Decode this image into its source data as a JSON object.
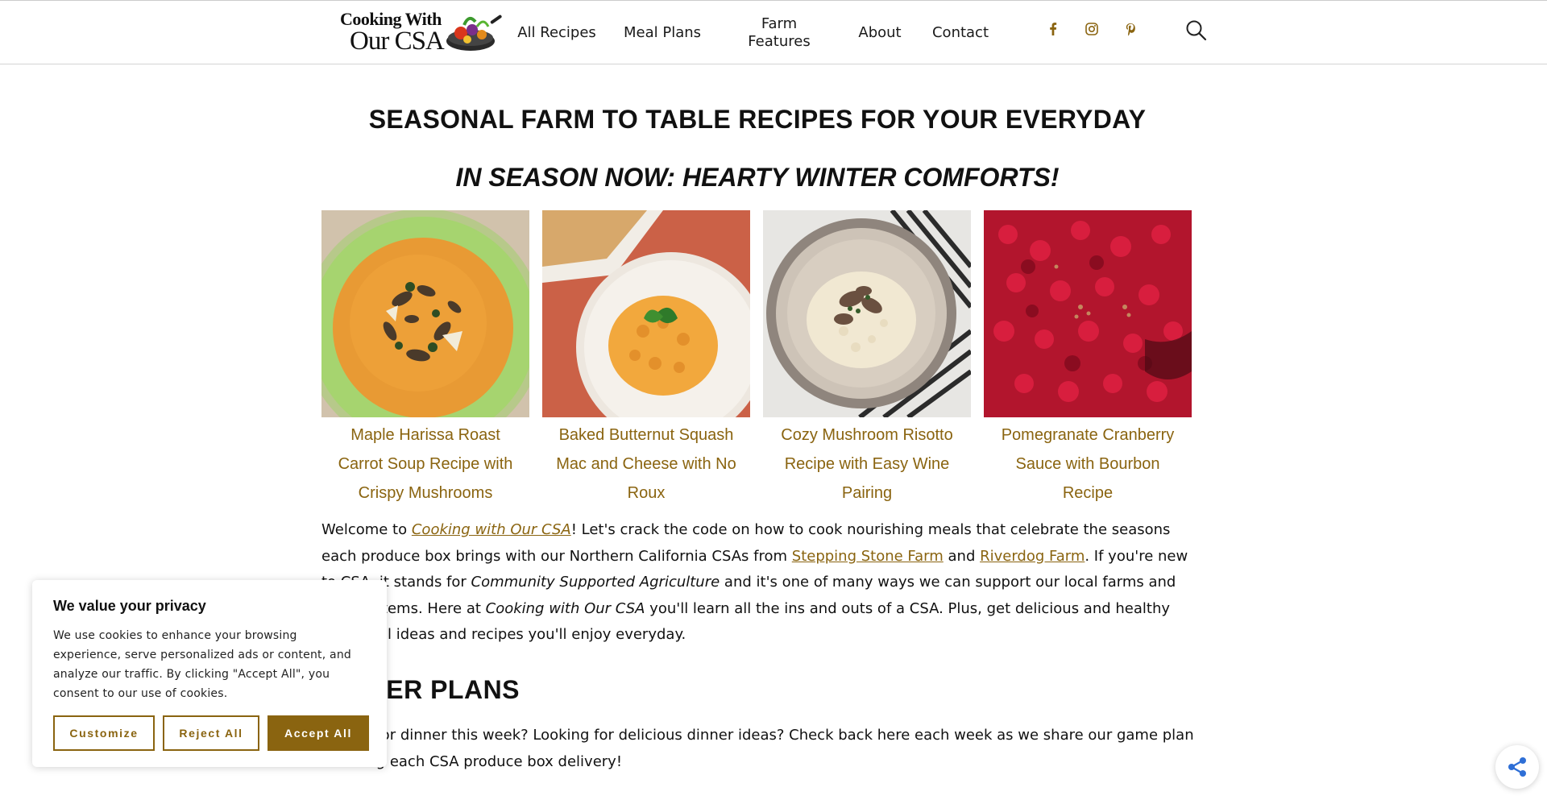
{
  "header": {
    "logo_line1": "Cooking With",
    "logo_line2": "Our CSA",
    "nav": [
      {
        "label": "All Recipes"
      },
      {
        "label": "Meal Plans"
      },
      {
        "label": "Farm Features"
      },
      {
        "label": "About"
      },
      {
        "label": "Contact"
      }
    ],
    "social_icons": [
      "facebook-icon",
      "instagram-icon",
      "pinterest-icon"
    ],
    "search_icon": "search-icon"
  },
  "main": {
    "title": "SEASONAL FARM TO TABLE RECIPES FOR YOUR EVERYDAY",
    "season_title": "IN SEASON NOW: HEARTY WINTER COMFORTS!",
    "cards": [
      {
        "title": "Maple Harissa Roast Carrot Soup Recipe with Crispy Mushrooms"
      },
      {
        "title": "Baked Butternut Squash Mac and Cheese with No Roux"
      },
      {
        "title": "Cozy Mushroom Risotto Recipe with Easy Wine Pairing"
      },
      {
        "title": "Pomegranate Cranberry Sauce with Bourbon Recipe"
      }
    ],
    "intro": {
      "p1": "Welcome to ",
      "link1": "Cooking with Our CSA",
      "p2": "! Let's crack the code on how to cook nourishing meals that celebrate the seasons each produce box brings with our Northern California CSAs from ",
      "link2": "Stepping Stone Farm",
      "p3": " and ",
      "link3": "Riverdog Farm",
      "p4": ". If you're new to CSA, it stands for ",
      "em1": "Community Supported Agriculture",
      "p5": " and it's one of many ways we can support our local farms and food systems. Here at ",
      "em2": "Cooking with Our CSA",
      "p6": " you'll learn all the ins and outs of a CSA. Plus, get delicious and healthy CSA meal ideas and recipes you'll enjoy everyday."
    },
    "section_heading": "DINNER PLANS",
    "section_text": "What's for dinner this week? Looking for delicious dinner ideas? Check back here each week as we share our game plan for using each CSA produce box delivery!"
  },
  "cookie": {
    "title": "We value your privacy",
    "text": "We use cookies to enhance your browsing experience, serve personalized ads or content, and analyze our traffic. By clicking \"Accept All\", you consent to our use of cookies.",
    "customize": "Customize",
    "reject": "Reject All",
    "accept": "Accept All"
  },
  "colors": {
    "accent": "#8a6410"
  }
}
